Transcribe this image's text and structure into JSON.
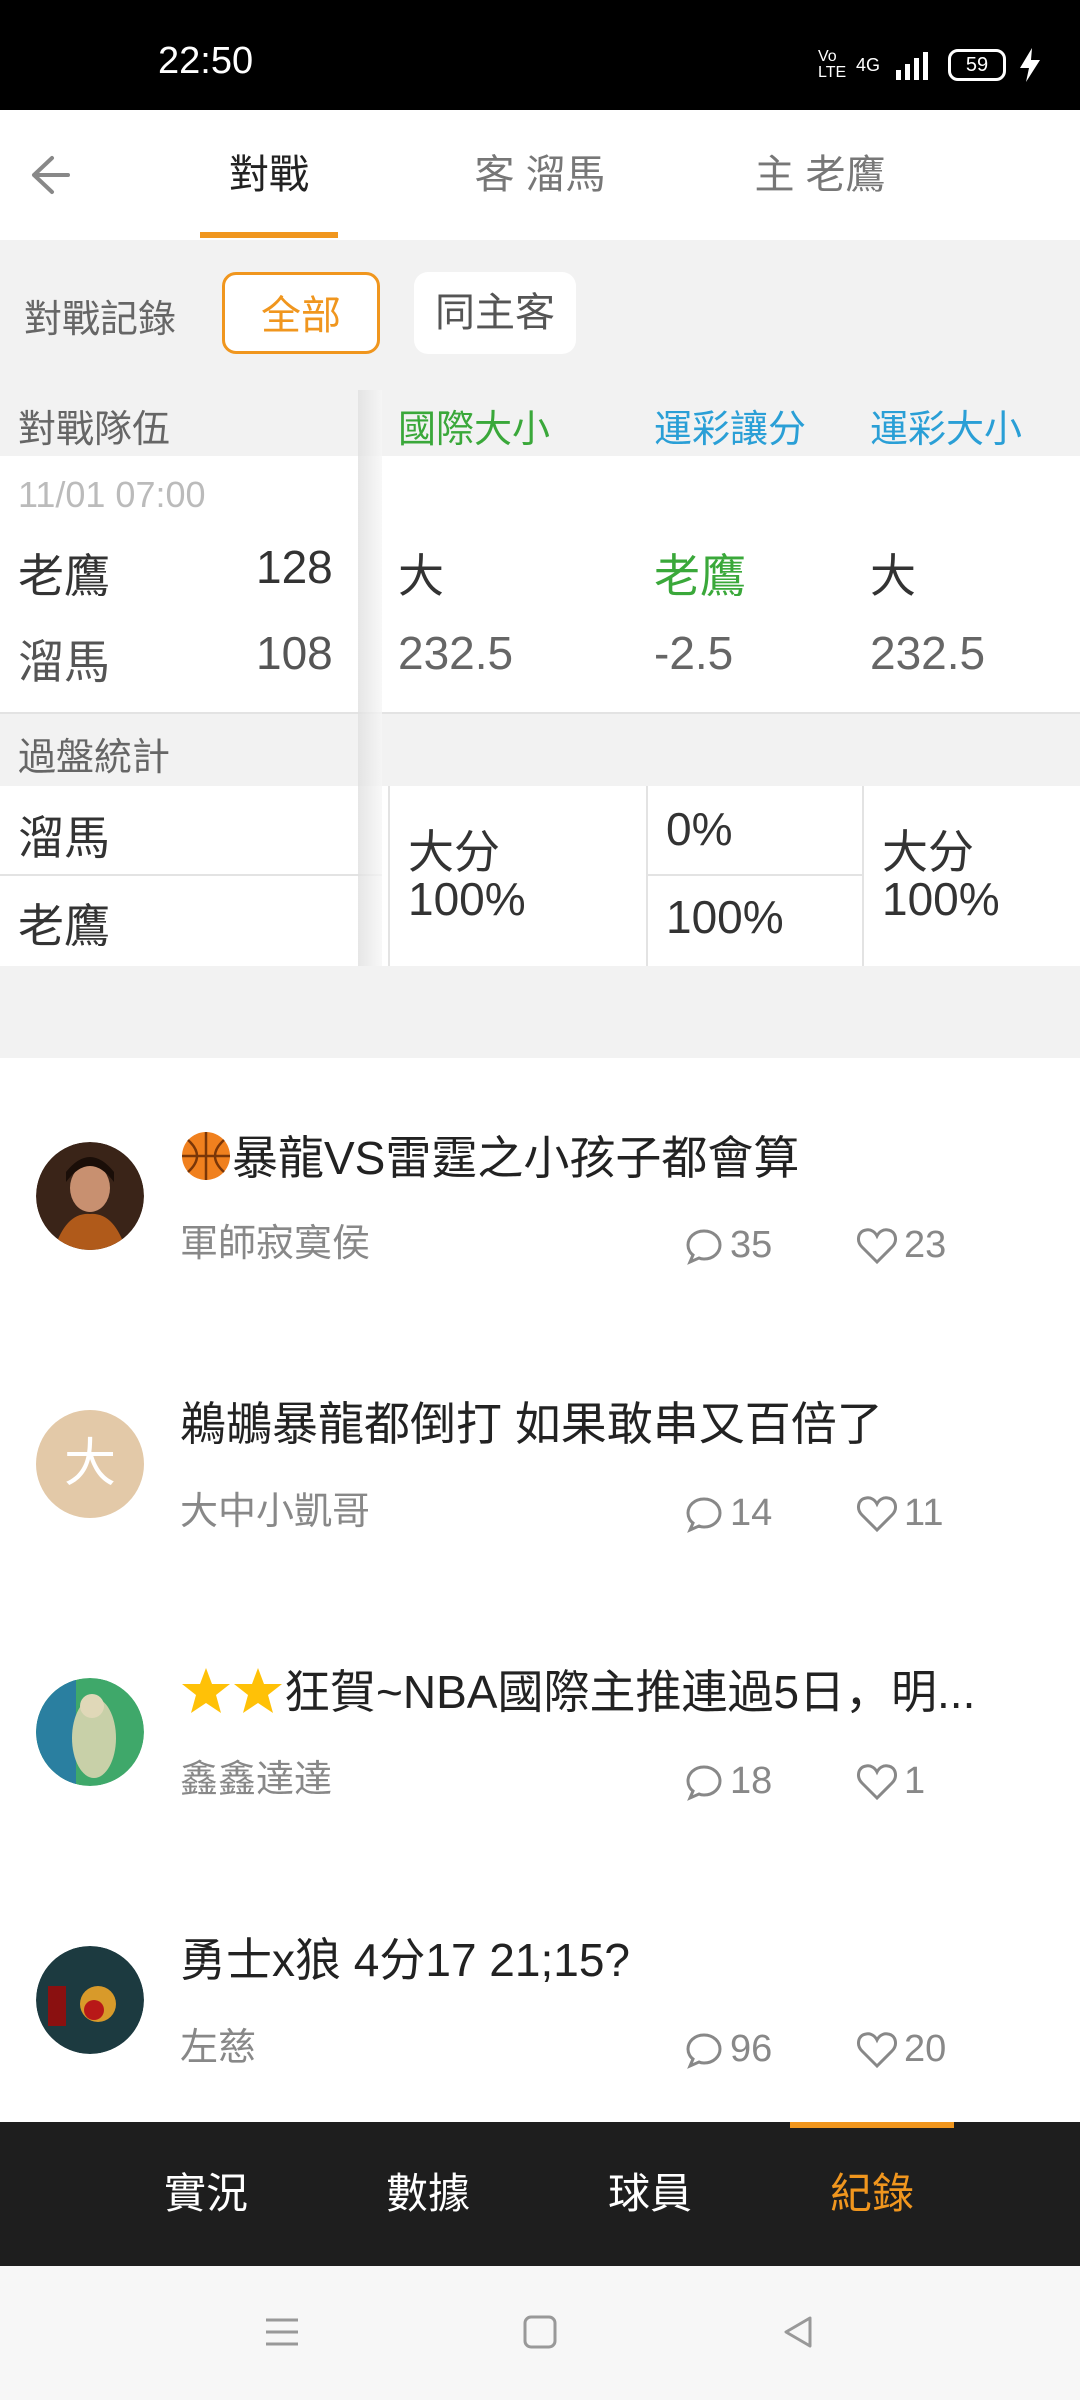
{
  "status": {
    "time": "22:50",
    "network": "4G",
    "volte": "Vo LTE",
    "battery": "59"
  },
  "header": {
    "tabs": [
      {
        "label": "對戰"
      },
      {
        "label": "客 溜馬"
      },
      {
        "label": "主 老鷹"
      }
    ]
  },
  "filter": {
    "label": "對戰記錄",
    "options": [
      "全部",
      "同主客"
    ]
  },
  "table": {
    "headers": {
      "team": "對戰隊伍",
      "intl": "國際大小",
      "spread": "運彩讓分",
      "total": "運彩大小"
    },
    "match": {
      "datetime": "11/01 07:00",
      "home": {
        "name": "老鷹",
        "score": "128"
      },
      "away": {
        "name": "溜馬",
        "score": "108"
      },
      "intl": {
        "result": "大",
        "line": "232.5"
      },
      "spread": {
        "result": "老鷹",
        "line": "-2.5"
      },
      "total": {
        "result": "大",
        "line": "232.5"
      }
    },
    "stats": {
      "title": "過盤統計",
      "teams": [
        "溜馬",
        "老鷹"
      ],
      "intl": {
        "label": "大分",
        "pct": "100%"
      },
      "spread": {
        "top": "0%",
        "bottom": "100%"
      },
      "total": {
        "label": "大分",
        "pct": "100%"
      }
    }
  },
  "posts": [
    {
      "title": "暴龍VS雷霆之小孩子都會算",
      "author": "軍師寂寞侯",
      "comments": "35",
      "likes": "23",
      "avatar": "photo",
      "icon": "basketball-emoji"
    },
    {
      "title": "鵜鶘暴龍都倒打 如果敢串又百倍了",
      "author": "大中小凱哥",
      "comments": "14",
      "likes": "11",
      "avatar": "大"
    },
    {
      "title": "狂賀~NBA國際主推連過5日，明...",
      "author": "鑫鑫達達",
      "comments": "18",
      "likes": "1",
      "avatar": "photo",
      "icon": "star-emoji"
    },
    {
      "title": "勇士x狼 4分17 21;15?",
      "author": "左慈",
      "comments": "96",
      "likes": "20",
      "avatar": "photo"
    }
  ],
  "bottom_nav": [
    {
      "label": "實況"
    },
    {
      "label": "數據"
    },
    {
      "label": "球員"
    },
    {
      "label": "紀錄",
      "active": true
    }
  ],
  "colors": {
    "accent": "#f0961e",
    "green": "#3aa83a",
    "blue": "#2a9fd6",
    "dark_nav": "#1e1e1e"
  }
}
